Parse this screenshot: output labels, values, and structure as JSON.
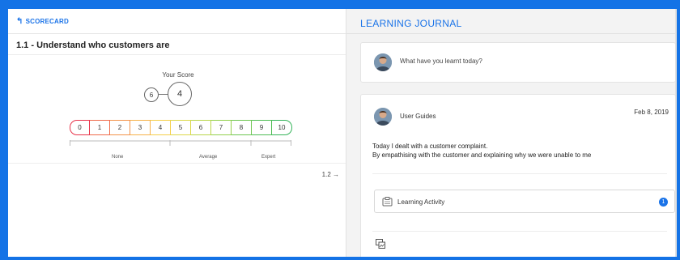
{
  "left": {
    "back_label": "SCORECARD",
    "section_title": "1.1 - Understand who customers are",
    "score": {
      "label": "Your Score",
      "target": "6",
      "current": "4",
      "scale": [
        "0",
        "1",
        "2",
        "3",
        "4",
        "5",
        "6",
        "7",
        "8",
        "9",
        "10"
      ],
      "scale_colors": [
        "#e8334a",
        "#ef6a4a",
        "#f3934a",
        "#f6b24a",
        "#f4cf49",
        "#dcd84a",
        "#b9d64b",
        "#93d04d",
        "#6dc651",
        "#4fbd55",
        "#35b45a"
      ],
      "bands": [
        "None",
        "Average",
        "Expert"
      ]
    },
    "next_label": "1.2 →"
  },
  "right": {
    "title": "LEARNING JOURNAL",
    "prompt_placeholder": "What have you learnt today?",
    "entry": {
      "author": "User Guides",
      "date": "Feb 8, 2019",
      "lines": [
        "Today I dealt with a customer complaint.",
        "By empathising with the customer and explaining why we were unable to me"
      ],
      "activity_label": "Learning Activity",
      "activity_count": "1"
    }
  },
  "colors": {
    "accent": "#1a73e8",
    "frame": "#1473e6"
  }
}
